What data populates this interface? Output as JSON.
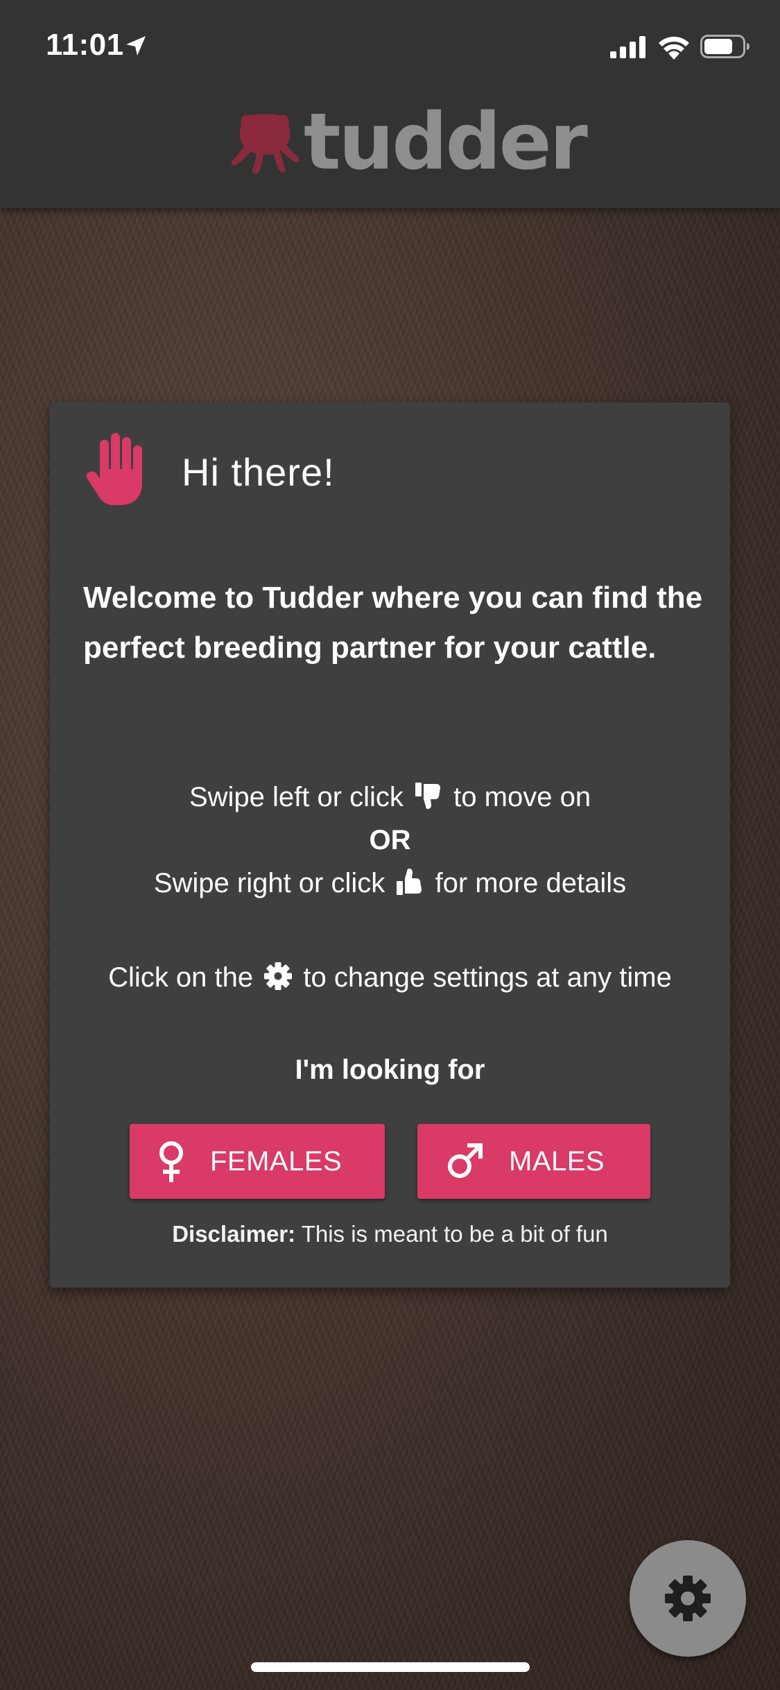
{
  "status_bar": {
    "time": "11:01"
  },
  "header": {
    "logo_text": "tudder"
  },
  "card": {
    "title": "Hi there!",
    "welcome": "Welcome to Tudder where you can find the perfect breeding partner for your cattle.",
    "swipe_left_prefix": "Swipe left or click",
    "swipe_left_suffix": "to move on",
    "or_text": "OR",
    "swipe_right_prefix": "Swipe right or click",
    "swipe_right_suffix": "for more details",
    "settings_prefix": "Click on the",
    "settings_suffix": "to change settings at any time",
    "looking_for": "I'm looking for",
    "females_label": "FEMALES",
    "males_label": "MALES",
    "disclaimer_label": "Disclaimer:",
    "disclaimer_text": " This is meant to be a bit of fun"
  },
  "icons": {
    "hand": "hand-icon",
    "thumbs_down": "thumbs-down-icon",
    "thumbs_up": "thumbs-up-icon",
    "gear": "gear-icon",
    "female": "female-icon",
    "male": "male-icon"
  },
  "colors": {
    "accent": "#d93a66",
    "header_bg": "#333333",
    "card_bg": "#3f3f3f",
    "logo_text": "#8e8e8e",
    "logo_icon": "#8a2a3c",
    "fab_bg": "#8b8b8b"
  }
}
